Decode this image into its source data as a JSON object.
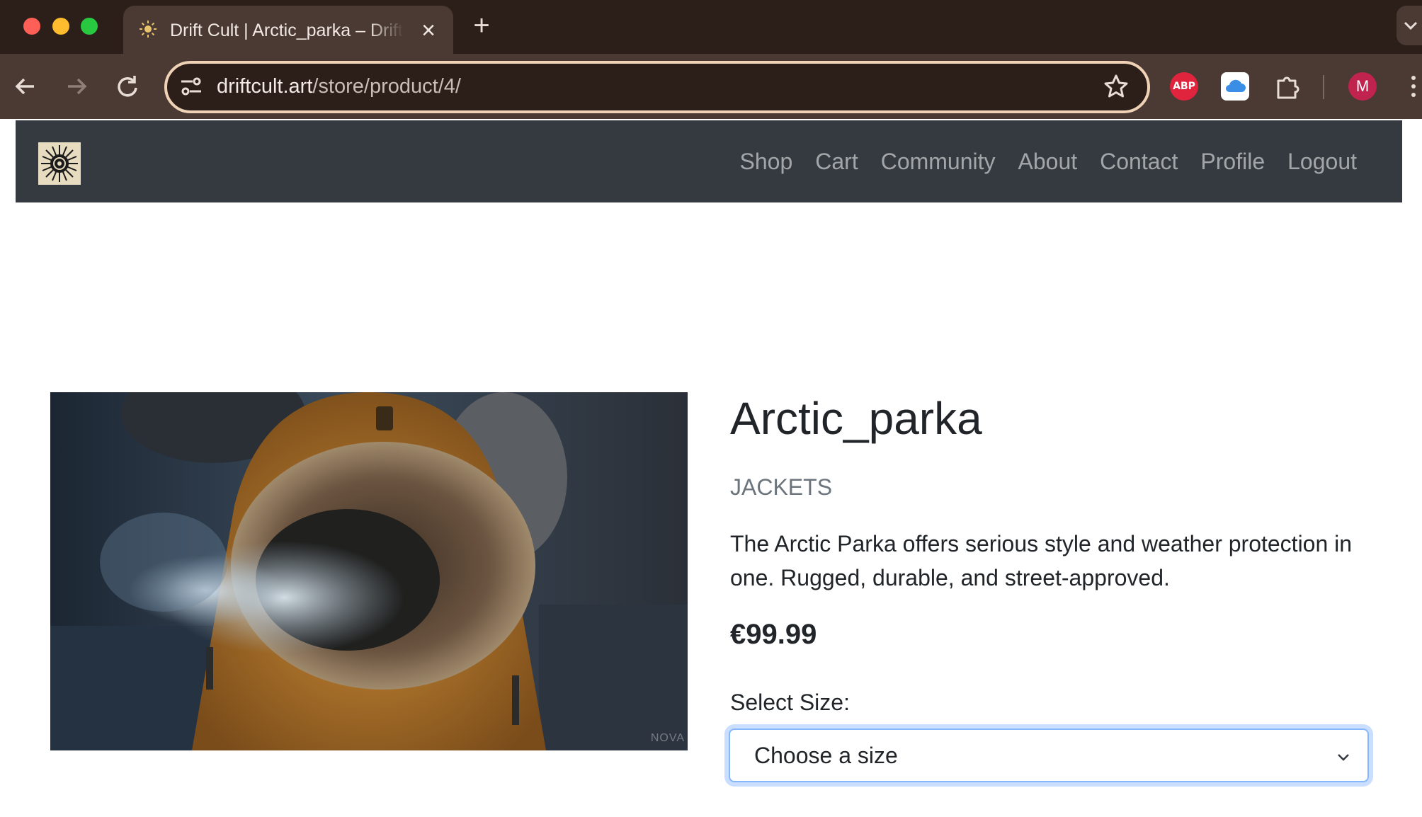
{
  "browser": {
    "tab": {
      "title": "Drift Cult | Arctic_parka – Drift Cult",
      "favicon": "sun-favicon-icon",
      "close_icon": "×"
    },
    "new_tab_icon": "+",
    "address_bar": {
      "host": "driftcult.art",
      "path": "/store/product/4/"
    },
    "extensions": {
      "adblock_label": "ABP",
      "icloud": "cloud-icon",
      "extensions_menu": "puzzle-icon"
    },
    "profile_initial": "M",
    "colors": {
      "tabstrip": "#2c1f1a",
      "toolbar": "#4a3a33",
      "omnibox_border": "#f0d2b6",
      "abp": "#e0243d",
      "avatar": "#c0234e"
    }
  },
  "site": {
    "nav": {
      "logo": "sun-logo-icon",
      "links": [
        "Shop",
        "Cart",
        "Community",
        "About",
        "Contact",
        "Profile",
        "Logout"
      ],
      "background": "#343a40"
    },
    "product": {
      "image_watermark": "NOVA",
      "title": "Arctic_parka",
      "category": "JACKETS",
      "description": "The Arctic Parka offers serious style and weather protection in one. Rugged, durable, and street-approved.",
      "price": "€99.99",
      "size_label": "Select Size:",
      "size_select": {
        "selected": "Choose a size"
      }
    }
  }
}
